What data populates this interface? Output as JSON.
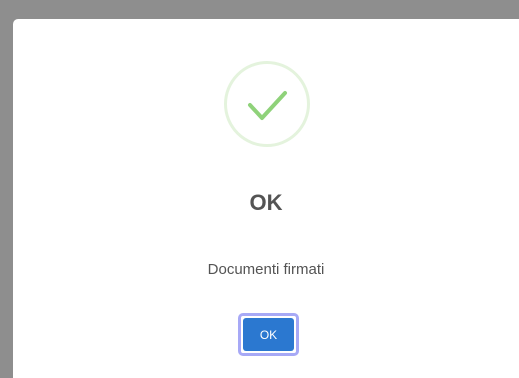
{
  "dialog": {
    "icon": "success-check-icon",
    "title": "OK",
    "message": "Documenti firmati",
    "confirm_label": "OK"
  },
  "colors": {
    "backdrop": "#8e8e8e",
    "icon_ring": "#e4f3dd",
    "icon_check": "#8fd27a",
    "title_text": "#545454",
    "button_bg": "#2b78d0",
    "button_focus_ring": "#a7a9f6"
  }
}
